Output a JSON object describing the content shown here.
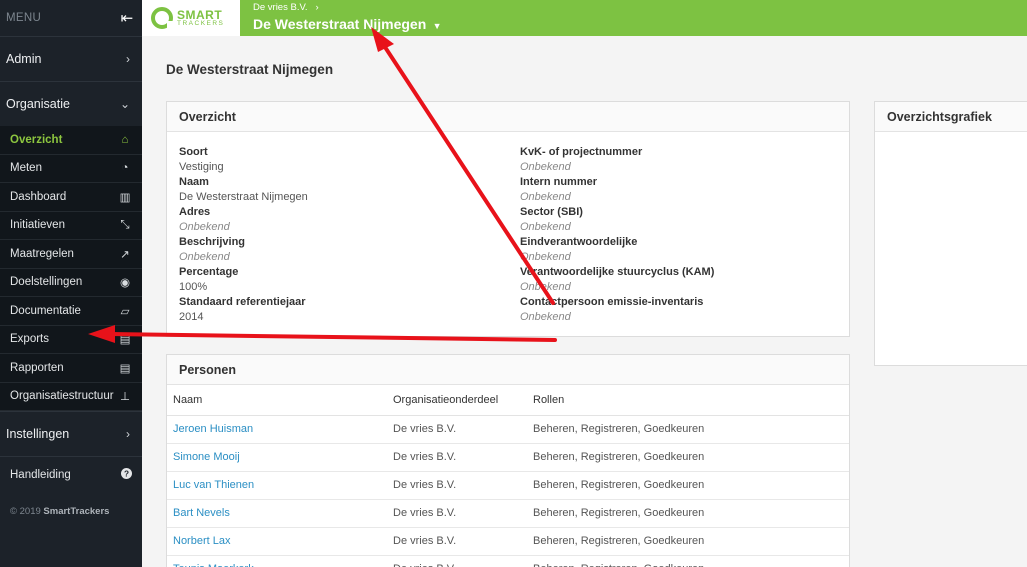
{
  "sidebar": {
    "menu_label": "MENU",
    "admin": "Admin",
    "organisatie": "Organisatie",
    "items": [
      {
        "label": "Overzicht",
        "icon": "home-icon",
        "glyph": "⌂",
        "active": true
      },
      {
        "label": "Meten",
        "icon": "dashboard-gauge-icon",
        "glyph": "◔",
        "active": false
      },
      {
        "label": "Dashboard",
        "icon": "bar-chart-icon",
        "glyph": "▥",
        "active": false
      },
      {
        "label": "Initiatieven",
        "icon": "compress-icon",
        "glyph": "⤡",
        "active": false
      },
      {
        "label": "Maatregelen",
        "icon": "line-chart-icon",
        "glyph": "↗",
        "active": false
      },
      {
        "label": "Doelstellingen",
        "icon": "target-icon",
        "glyph": "◉",
        "active": false
      },
      {
        "label": "Documentatie",
        "icon": "folder-open-icon",
        "glyph": "▱",
        "active": false
      },
      {
        "label": "Exports",
        "icon": "export-icon",
        "glyph": "▤",
        "active": false
      },
      {
        "label": "Rapporten",
        "icon": "file-icon",
        "glyph": "▤",
        "active": false
      },
      {
        "label": "Organisatiestructuur",
        "icon": "sitemap-icon",
        "glyph": "⊥",
        "active": false
      }
    ],
    "instellingen": "Instellingen",
    "handleiding": "Handleiding",
    "copyright_prefix": "© 2019",
    "copyright_brand": "SmartTrackers"
  },
  "header": {
    "logo_line1": "SMART",
    "logo_line2": "TRACKERS",
    "breadcrumb_parent": "De vries B.V.",
    "breadcrumb_current": "De Westerstraat Nijmegen",
    "accent": "#7dc242"
  },
  "page_title": "De Westerstraat Nijmegen",
  "overview": {
    "title": "Overzicht",
    "left": [
      {
        "label": "Soort",
        "value": "Vestiging",
        "empty": false
      },
      {
        "label": "Naam",
        "value": "De Westerstraat Nijmegen",
        "empty": false
      },
      {
        "label": "Adres",
        "value": "Onbekend",
        "empty": true
      },
      {
        "label": "Beschrijving",
        "value": "Onbekend",
        "empty": true
      },
      {
        "label": "Percentage",
        "value": "100%",
        "empty": false
      },
      {
        "label": "Standaard referentiejaar",
        "value": "2014",
        "empty": false
      }
    ],
    "right": [
      {
        "label": "KvK- of projectnummer",
        "value": "Onbekend",
        "empty": true
      },
      {
        "label": "Intern nummer",
        "value": "Onbekend",
        "empty": true
      },
      {
        "label": "Sector (SBI)",
        "value": "Onbekend",
        "empty": true
      },
      {
        "label": "Eindverantwoordelijke",
        "value": "Onbekend",
        "empty": true
      },
      {
        "label": "Verantwoordelijke stuurcyclus (KAM)",
        "value": "Onbekend",
        "empty": true
      },
      {
        "label": "Contactpersoon emissie-inventaris",
        "value": "Onbekend",
        "empty": true
      }
    ]
  },
  "chart_panel": {
    "title": "Overzichtsgrafiek"
  },
  "persons": {
    "title": "Personen",
    "columns": [
      "Naam",
      "Organisatieonderdeel",
      "Rollen"
    ],
    "rows": [
      [
        "Jeroen Huisman",
        "De vries B.V.",
        "Beheren, Registreren, Goedkeuren"
      ],
      [
        "Simone Mooij",
        "De vries B.V.",
        "Beheren, Registreren, Goedkeuren"
      ],
      [
        "Luc van Thienen",
        "De vries B.V.",
        "Beheren, Registreren, Goedkeuren"
      ],
      [
        "Bart Nevels",
        "De vries B.V.",
        "Beheren, Registreren, Goedkeuren"
      ],
      [
        "Norbert Lax",
        "De vries B.V.",
        "Beheren, Registreren, Goedkeuren"
      ],
      [
        "Teunis Moerkerk",
        "De vries B.V.",
        "Beheren, Registreren, Goedkeuren"
      ]
    ]
  },
  "annotation_color": "#e8121a"
}
